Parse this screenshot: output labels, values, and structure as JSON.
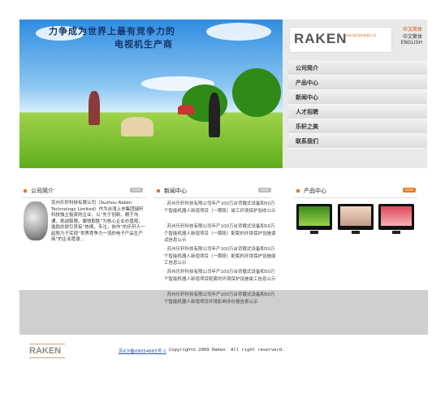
{
  "hero": {
    "slogan_line1": "力争成为世界上最有竞争力的",
    "slogan_line2": "电视机生产商"
  },
  "brand": {
    "logo_text": "RAKEN",
    "logo_subtitle": "苏州乐轩科技有限公司"
  },
  "languages": [
    "中文简体",
    "中文繁体",
    "ENGLISH"
  ],
  "menu": [
    "公司简介",
    "产品中心",
    "新闻中心",
    "人才招聘",
    "乐轩之美",
    "联系我们"
  ],
  "sections": {
    "company": {
      "title": "公司简介",
      "more": "MORE",
      "text": "苏州乐轩科技有限公司（Suzhou Raken Technology Limited）作为台湾上市集团瑞轩科技独立投资的企业，以“先于创新，精于沟通，挑战极限，偏快取胜”为核心企业价值观，激励并提引员有“热情，专注，协作”的乐轩人一起努力于实现“世界竞争力一流的电子产品生产商”的企业愿景..."
    },
    "news": {
      "title": "新闻中心",
      "more": "MORE",
      "items": [
        "苏州乐轩科技有限公司年产100万台背载式设备和50万个智能机器人新增项目（一期段）竣工环境保护验收公示",
        "苏州乐轩科技有限公司年产100万台背载式设备和50万个智能机器人新增项目（一期段）配套的环境保护设施调试信息公示",
        "苏州乐轩科技有限公司年产100万台背载式设备和50万个智能机器人新增项目（一期段）配套的环境保护设施竣工信息公示",
        "苏州乐轩科技有限公司年产100万台背载式设备和50万个智能机器人新增项目配套的环境保护设施竣工信息公示",
        "苏州乐轩科技有限公司年产100万台背载式设备和50万个智能机器人新增项目环境影响评价报告表公示"
      ]
    },
    "products": {
      "title": "产品中心",
      "more": "MORE"
    }
  },
  "footer": {
    "logo_text": "RAKEN",
    "icp": "苏ICP备09054665号-1",
    "copyright": "Copyright© 2009 Raken. All right reserverd."
  },
  "colors": {
    "accent": "#e07b2a",
    "menu_bg": "#e9e9e9",
    "band_gray": "#cfcfcf"
  }
}
